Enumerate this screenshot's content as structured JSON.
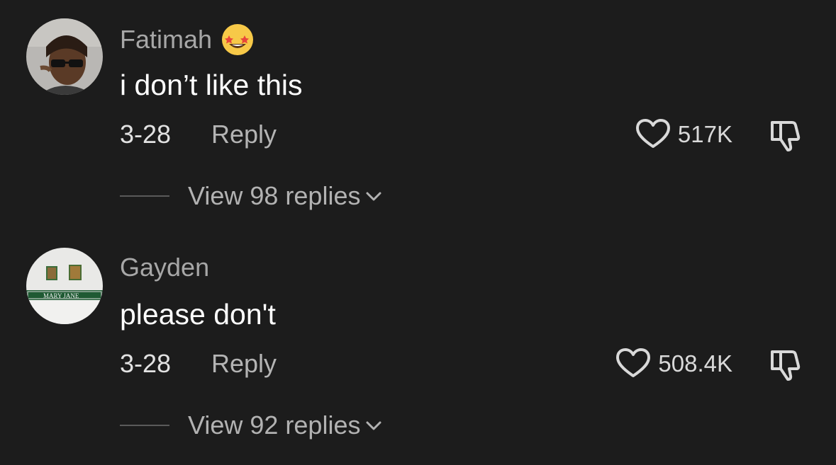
{
  "comments": [
    {
      "username": "Fatimah",
      "emoji": "star-struck-emoji",
      "text": "i don’t like this",
      "date": "3-28",
      "reply_label": "Reply",
      "likes": "517K",
      "view_replies": "View 98 replies"
    },
    {
      "username": "Gayden",
      "text": "please don't",
      "date": "3-28",
      "reply_label": "Reply",
      "likes": "508.4K",
      "view_replies": "View 92 replies",
      "avatar_sign_text": "MARY JANE"
    }
  ],
  "colors": {
    "background": "#1c1c1c",
    "username": "#a7a7a7",
    "text": "#ffffff",
    "secondary": "#b4b4b4"
  }
}
